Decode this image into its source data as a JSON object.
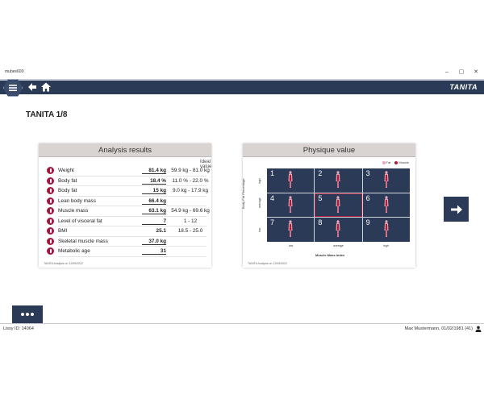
{
  "window": {
    "title": "mubes600",
    "controls": [
      "–",
      "▢",
      "✕"
    ]
  },
  "header": {
    "brand": "TANITA",
    "icons": [
      "menu-icon",
      "back-arrow-icon",
      "home-icon"
    ],
    "accent_color": "#2b3a56"
  },
  "page": {
    "title": "TANITA 1/8"
  },
  "analysis": {
    "title": "Analysis results",
    "ideal_header": "Ideal value",
    "footer": "TANITA Analysis on 12/09/2022",
    "rows": [
      {
        "label": "Weight",
        "value": "81.4 kg",
        "ideal": "59.9 kg - 81.0 kg",
        "underline": true
      },
      {
        "label": "Body fat",
        "value": "18.4 %",
        "ideal": "11.0 % - 22.0 %",
        "underline": true
      },
      {
        "label": "Body fat",
        "value": "15 kg",
        "ideal": "9.0 kg - 17.9 kg",
        "underline": true
      },
      {
        "label": "Lean body mass",
        "value": "66.4 kg",
        "ideal": "",
        "underline": true
      },
      {
        "label": "Muscle mass",
        "value": "63.1 kg",
        "ideal": "54.9 kg - 69.6 kg",
        "underline": true
      },
      {
        "label": "Level of visceral fat",
        "value": "7",
        "ideal": "1 - 12",
        "underline": true
      },
      {
        "label": "BMI",
        "value": "25.1",
        "ideal": "18.5 - 25.0",
        "underline": false
      },
      {
        "label": "Skeletal muscle mass",
        "value": "37.0 kg",
        "ideal": "",
        "underline": true
      },
      {
        "label": "Metabolic age",
        "value": "31",
        "ideal": "",
        "underline": true
      }
    ],
    "icon_color": "#a01840"
  },
  "physique": {
    "title": "Physique value",
    "legend": [
      {
        "label": "Fat",
        "color": "#e8a8b8"
      },
      {
        "label": "Muscle",
        "color": "#b01a3a"
      }
    ],
    "y_axis_label": "Body Fat Percentage",
    "y_ticks": [
      "high",
      "average",
      "low"
    ],
    "x_axis_label": "Muscle Mass Index",
    "x_ticks": [
      "low",
      "average",
      "high"
    ],
    "cells": [
      "1",
      "2",
      "3",
      "4",
      "5",
      "6",
      "7",
      "8",
      "9"
    ],
    "selected": "5",
    "footer": "TANITA Analysis on 12/09/2022"
  },
  "actions": {
    "next_icon": "arrow-right-icon",
    "more_icon": "more-dots-icon"
  },
  "status": {
    "left": "Lissy ID: 14064",
    "right": "Max Mustermann, 01/02/1981 (41)",
    "user_icon": "user-icon"
  }
}
